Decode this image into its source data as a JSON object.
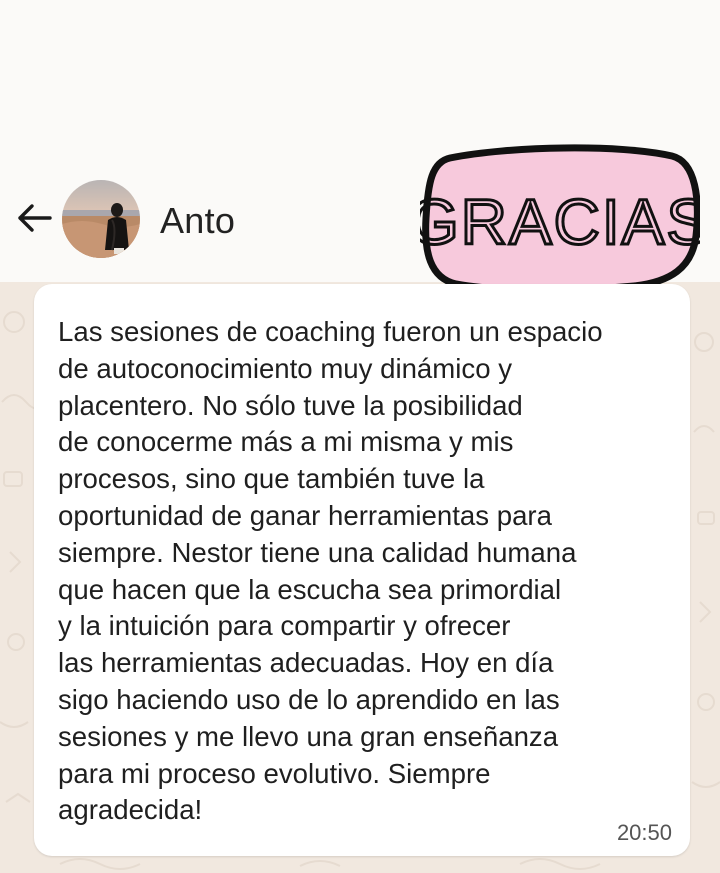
{
  "header": {
    "contact_name": "Anto",
    "badge_text": "GRACIAS"
  },
  "colors": {
    "badge_fill": "#f7c9dc",
    "badge_outline": "#111111",
    "chat_background": "#f1e8df",
    "bubble": "#ffffff"
  },
  "icons": {
    "back": "arrow-left-icon"
  },
  "message": {
    "lines": [
      "Las sesiones de coaching fueron un espacio",
      "de autoconocimiento muy dinámico y",
      "placentero. No sólo tuve la posibilidad",
      "de conocerme más a mi misma y mis",
      "procesos, sino que también tuve la",
      "oportunidad de ganar herramientas para",
      "siempre. Nestor tiene una calidad humana",
      "que hacen que la escucha sea primordial",
      "y la intuición para compartir y ofrecer",
      "las herramientas adecuadas. Hoy en día",
      "sigo haciendo uso de lo aprendido en las",
      "sesiones y me llevo una gran enseñanza",
      "para mi proceso evolutivo. Siempre",
      "agradecida!"
    ],
    "time": "20:50"
  }
}
